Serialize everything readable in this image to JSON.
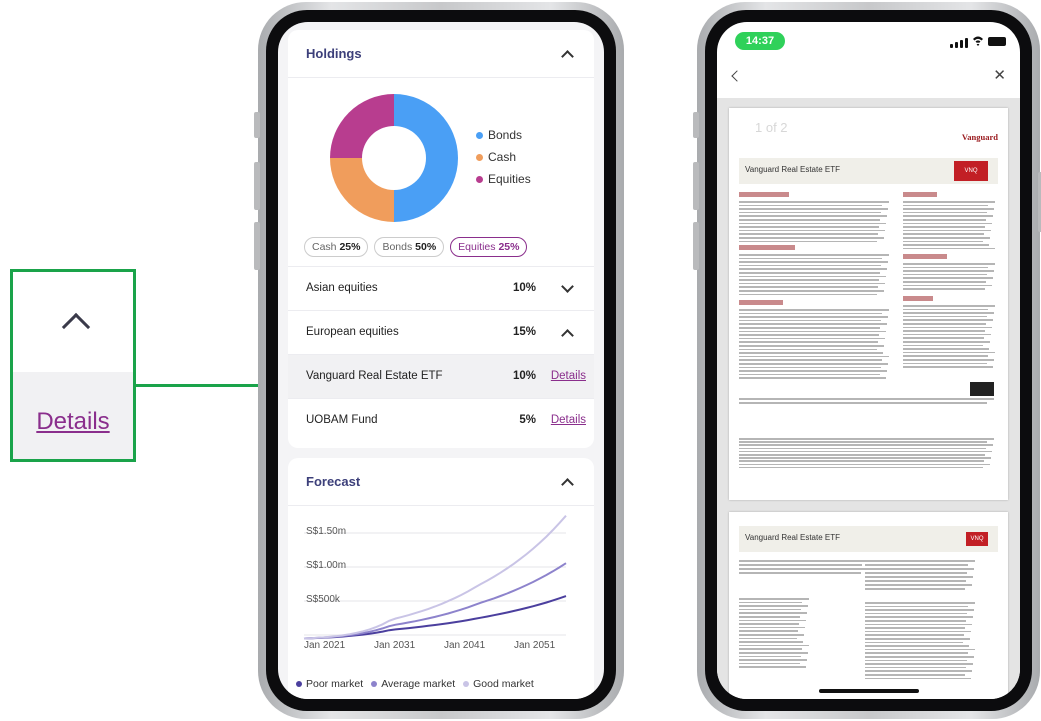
{
  "callout": {
    "link_label": "Details"
  },
  "holdings": {
    "title": "Holdings",
    "legend": [
      {
        "label": "Bonds",
        "color": "#4a9ff5"
      },
      {
        "label": "Cash",
        "color": "#f09d5c"
      },
      {
        "label": "Equities",
        "color": "#b83d8f"
      }
    ],
    "allocation": {
      "bonds": 50,
      "cash": 25,
      "equities": 25
    },
    "pills": [
      {
        "name": "Cash",
        "value": "25%"
      },
      {
        "name": "Bonds",
        "value": "50%"
      },
      {
        "name": "Equities",
        "value": "25%"
      }
    ],
    "rows": [
      {
        "name": "Asian equities",
        "pct": "10%"
      },
      {
        "name": "European equities",
        "pct": "15%"
      },
      {
        "name": "Vanguard Real Estate ETF",
        "pct": "10%",
        "link": "Details"
      },
      {
        "name": "UOBAM Fund",
        "pct": "5%",
        "link": "Details"
      }
    ]
  },
  "forecast": {
    "title": "Forecast",
    "y_ticks": [
      "S$1.50m",
      "S$1.00m",
      "S$500k"
    ],
    "x_ticks": [
      "Jan 2021",
      "Jan 2031",
      "Jan 2041",
      "Jan 2051"
    ],
    "legend": [
      {
        "label": "Poor market",
        "color": "#4b3f9e"
      },
      {
        "label": "Average market",
        "color": "#8d83cc"
      },
      {
        "label": "Good market",
        "color": "#c9c4e6"
      }
    ]
  },
  "chart_data": {
    "type": "line",
    "x": [
      "Jan 2021",
      "Jan 2031",
      "Jan 2041",
      "Jan 2051"
    ],
    "series": [
      {
        "name": "Poor market",
        "values": [
          0.02,
          0.14,
          0.3,
          0.6
        ]
      },
      {
        "name": "Average market",
        "values": [
          0.02,
          0.2,
          0.5,
          1.05
        ]
      },
      {
        "name": "Good market",
        "values": [
          0.02,
          0.28,
          0.75,
          1.7
        ]
      }
    ],
    "yticks": [
      "S$1.50m",
      "S$1.00m",
      "S$500k"
    ]
  },
  "pdf_viewer": {
    "time": "14:37",
    "page_indicator": "1 of 2",
    "brand": "Vanguard",
    "doc_title": "Vanguard Real Estate ETF",
    "ticker": "VNQ"
  }
}
